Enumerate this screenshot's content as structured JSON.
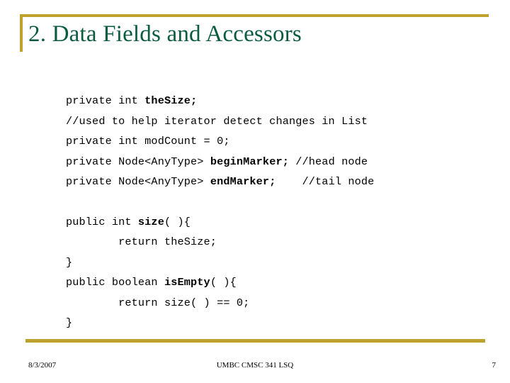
{
  "slide": {
    "title": "2. Data Fields and Accessors",
    "accent_color": "#bfa22e",
    "title_color": "#0b5c3e",
    "background_color": "#ffffff"
  },
  "code": {
    "fields_block": [
      {
        "plain_before": "private int ",
        "bold": "theSize;",
        "plain_after": ""
      },
      {
        "plain_before": "//used to help iterator detect changes in List",
        "bold": "",
        "plain_after": ""
      },
      {
        "plain_before": "private int modCount = 0;",
        "bold": "",
        "plain_after": ""
      },
      {
        "plain_before": "private Node<AnyType> ",
        "bold": "beginMarker;",
        "plain_after": " //head node"
      },
      {
        "plain_before": "private Node<AnyType> ",
        "bold": "endMarker;",
        "plain_after": "    //tail node"
      }
    ],
    "accessors_block": [
      {
        "plain_before": "public int ",
        "bold": "size",
        "plain_after": "( ){"
      },
      {
        "plain_before": "        return theSize;",
        "bold": "",
        "plain_after": ""
      },
      {
        "plain_before": "}",
        "bold": "",
        "plain_after": ""
      },
      {
        "plain_before": "public boolean ",
        "bold": "isEmpty",
        "plain_after": "( ){"
      },
      {
        "plain_before": "        return size( ) == 0;",
        "bold": "",
        "plain_after": ""
      },
      {
        "plain_before": "}",
        "bold": "",
        "plain_after": ""
      }
    ]
  },
  "footer": {
    "date": "8/3/2007",
    "center": "UMBC CMSC 341 LSQ",
    "page_number": "7"
  }
}
